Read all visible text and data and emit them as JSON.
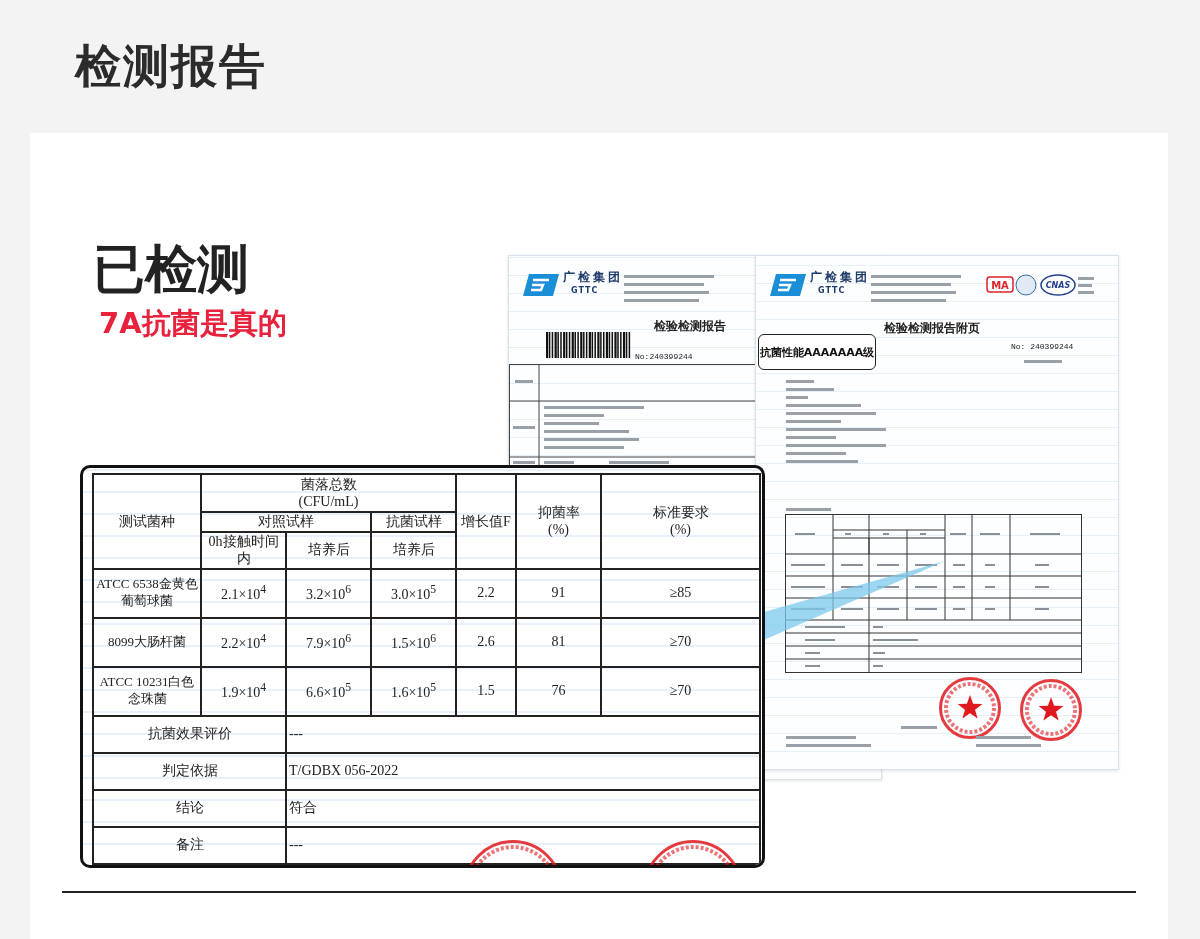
{
  "page_title": "检测报告",
  "headline": "已检测",
  "subheadline": "7A抗菌是真的",
  "report": {
    "brand": "广检集团",
    "brand_en": "GTTC",
    "title": "检验检测报告",
    "number": "No:240399244"
  },
  "appendix": {
    "brand": "广检集团",
    "brand_en": "GTTC",
    "cert_marks": [
      "MA",
      "CNAS"
    ],
    "title": "检验检测报告附页",
    "grade_label": "抗菌性能AAAAAAA级",
    "number": "No: 240399244"
  },
  "result_table": {
    "header": {
      "strain": "测试菌种",
      "colony_total": "菌落总数\n(CFU/mL)",
      "control_sample": "对照试样",
      "antibacterial_sample": "抗菌试样",
      "control_0h": "0h接触时间内",
      "control_after": "培养后",
      "antibacterial_after": "培养后",
      "growth": "增长值F",
      "inhibition": "抑菌率\n(%)",
      "standard": "标准要求\n(%)"
    },
    "rows": [
      {
        "strain": "ATCC 6538金黄色葡萄球菌",
        "values": [
          "2.1×10$^{4}$",
          "3.2×10$^{6}$",
          "3.0×10$^{5}$",
          "2.2",
          "91",
          "≥85"
        ]
      },
      {
        "strain": "8099大肠杆菌",
        "values": [
          "2.2×10$^{4}$",
          "7.9×10$^{6}$",
          "1.5×10$^{6}$",
          "2.6",
          "81",
          "≥70"
        ]
      },
      {
        "strain": "ATCC 10231白色念珠菌",
        "values": [
          "1.9×10$^{4}$",
          "6.6×10$^{5}$",
          "1.6×10$^{5}$",
          "1.5",
          "76",
          "≥70"
        ]
      }
    ],
    "summary": [
      {
        "label": "抗菌效果评价",
        "value": "---"
      },
      {
        "label": "判定依据",
        "value": "T/GDBX 056-2022"
      },
      {
        "label": "结论",
        "value": "符合"
      },
      {
        "label": "备注",
        "value": "---"
      }
    ]
  }
}
